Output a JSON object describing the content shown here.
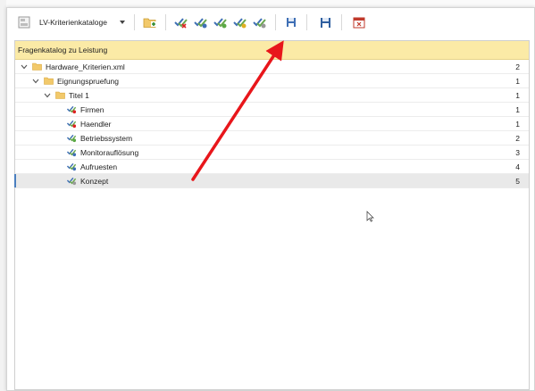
{
  "toolbar": {
    "catalog_combo_label": "LV-Kriterienkataloge",
    "icons": [
      "catalog-settings-icon",
      "new-folder-icon",
      "check-red-icon",
      "check-blue-icon",
      "check-green-icon",
      "check-yellow-icon",
      "check-gray-icon",
      "save-small-icon",
      "save-icon",
      "close-window-icon"
    ]
  },
  "panel": {
    "title": "Fragenkatalog zu Leistung",
    "rows": [
      {
        "label": "Hardware_Kriterien.xml",
        "count": "2",
        "level": 0,
        "type": "folder",
        "expanded": true
      },
      {
        "label": "Eignungspruefung",
        "count": "1",
        "level": 1,
        "type": "folder",
        "expanded": true
      },
      {
        "label": "Titel 1",
        "count": "1",
        "level": 2,
        "type": "folder",
        "expanded": true
      },
      {
        "label": "Firmen",
        "count": "1",
        "level": 3,
        "type": "criterion",
        "check": "red"
      },
      {
        "label": "Haendler",
        "count": "1",
        "level": 3,
        "type": "criterion",
        "check": "red"
      },
      {
        "label": "Betriebssystem",
        "count": "2",
        "level": 3,
        "type": "criterion",
        "check": "green"
      },
      {
        "label": "Monitorauflösung",
        "count": "3",
        "level": 3,
        "type": "criterion",
        "check": "blue"
      },
      {
        "label": "Aufruesten",
        "count": "4",
        "level": 3,
        "type": "criterion",
        "check": "blue"
      },
      {
        "label": "Konzept",
        "count": "5",
        "level": 3,
        "type": "criterion",
        "check": "gray",
        "selected": true
      }
    ]
  },
  "colors": {
    "header_bg": "#fbeaa6",
    "arrow": "#e8161b",
    "folder": "#f2c96b",
    "selection_marker": "#4a7fbf"
  }
}
